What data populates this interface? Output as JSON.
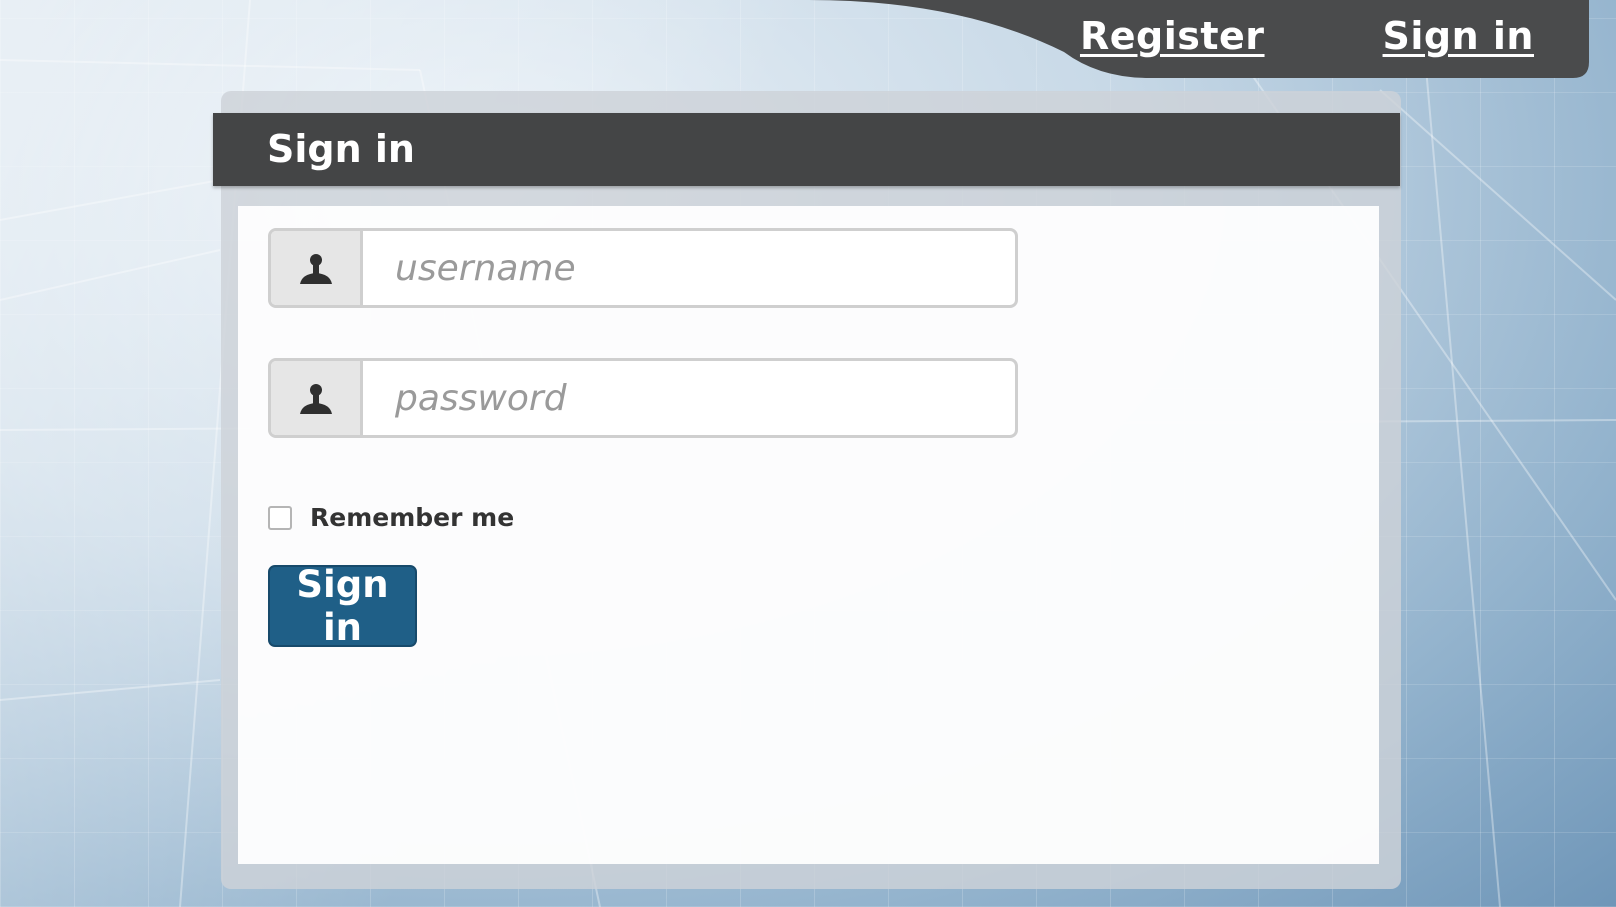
{
  "nav": {
    "register_label": "Register",
    "signin_label": "Sign in"
  },
  "panel": {
    "title": "Sign in"
  },
  "form": {
    "username_placeholder": "username",
    "username_value": "",
    "password_placeholder": "password",
    "password_value": "",
    "remember_label": "Remember me",
    "remember_checked": false,
    "submit_label": "Sign in"
  },
  "icons": {
    "username_icon": "user-icon",
    "password_icon": "user-icon"
  },
  "colors": {
    "header_bg": "#444546",
    "button_bg": "#1f5f87",
    "nav_bg": "#4a4b4c"
  }
}
